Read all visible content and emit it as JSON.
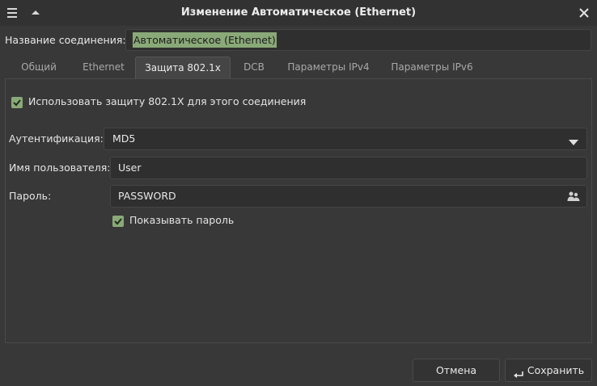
{
  "window": {
    "title": "Изменение Автоматическое (Ethernet)",
    "icons": [
      "menu-icon",
      "chevron-up-icon",
      "close-icon"
    ]
  },
  "connection": {
    "name_label": "Название соединения:",
    "name_value": "Автоматическое (Ethernet)"
  },
  "tabs": [
    {
      "label": "Общий",
      "active": false
    },
    {
      "label": "Ethernet",
      "active": false
    },
    {
      "label": "Защита 802.1x",
      "active": true
    },
    {
      "label": "DCB",
      "active": false
    },
    {
      "label": "Параметры IPv4",
      "active": false
    },
    {
      "label": "Параметры IPv6",
      "active": false
    }
  ],
  "security": {
    "use_8021x_label": "Использовать защиту 802.1X для этого соединения",
    "use_8021x_checked": true,
    "auth_label": "Аутентификация:",
    "auth_value": "MD5",
    "username_label": "Имя пользователя:",
    "username_value": "User",
    "password_label": "Пароль:",
    "password_value": "PASSWORD",
    "show_password_label": "Показывать пароль",
    "show_password_checked": true
  },
  "buttons": {
    "cancel": "Отмена",
    "save": "Сохранить"
  },
  "colors": {
    "accent": "#8aa978",
    "background": "#383838",
    "field": "#2f2f2f"
  }
}
